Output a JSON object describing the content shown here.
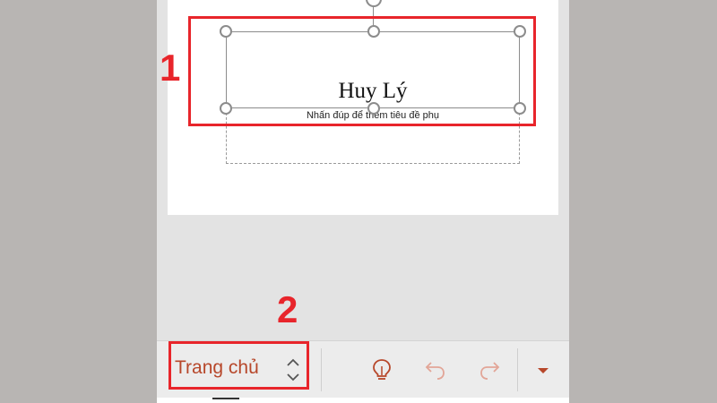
{
  "slide": {
    "title": "Huy Lý",
    "subtitle_placeholder": "Nhấn đúp để thêm tiêu đề phụ"
  },
  "toolbar": {
    "tab_label": "Trang chủ",
    "tab_switcher_icon": "chevron-up-down-icon",
    "buttons": [
      {
        "name": "ideas",
        "icon": "lightbulb-icon"
      },
      {
        "name": "undo",
        "icon": "undo-icon"
      },
      {
        "name": "redo",
        "icon": "redo-icon"
      },
      {
        "name": "more",
        "icon": "caret-down-icon"
      }
    ]
  },
  "annotations": {
    "step1": "1",
    "step2": "2",
    "color": "#e8252b"
  },
  "colors": {
    "accent": "#b7472a",
    "background": "#b8b5b3"
  }
}
